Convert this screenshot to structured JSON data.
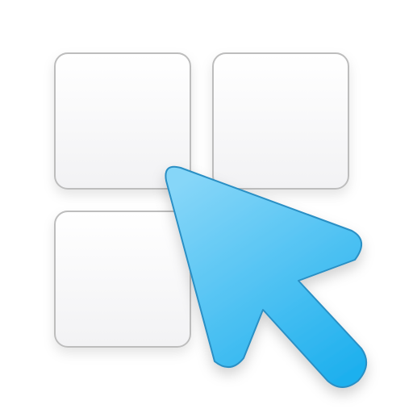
{
  "icon": {
    "name": "select-tiles-icon",
    "tiles": [
      {
        "name": "tile-top-left"
      },
      {
        "name": "tile-top-right"
      },
      {
        "name": "tile-bottom-left"
      }
    ],
    "pointer": {
      "name": "cursor-arrow-icon"
    },
    "colors": {
      "tile_fill_top": "#ffffff",
      "tile_fill_bottom": "#f2f2f4",
      "tile_border": "#bdbdbd",
      "pointer_fill_top": "#86d6f8",
      "pointer_fill_bottom": "#1fb0ee",
      "pointer_border": "#2a8fc4"
    }
  }
}
